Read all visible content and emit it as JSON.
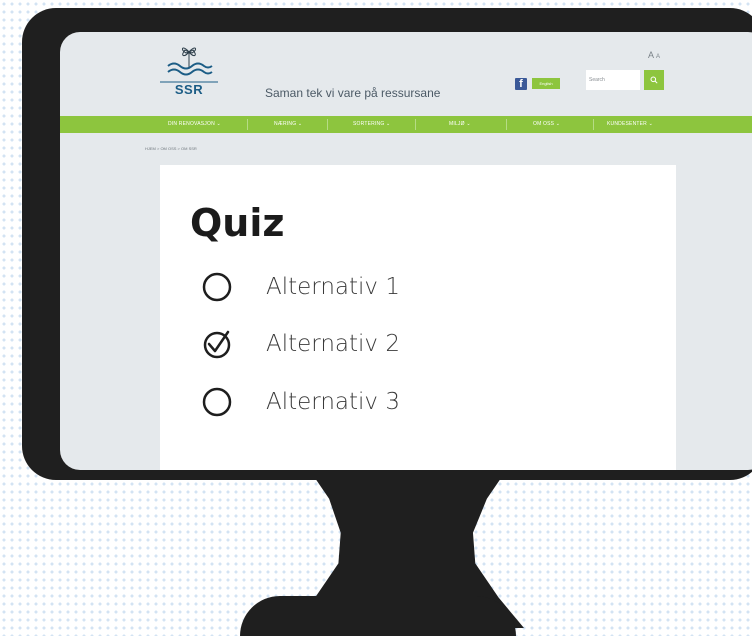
{
  "site": {
    "logo_text": "SSR",
    "tagline": "Saman tek vi vare på ressursane",
    "language_button": "English",
    "font_size_large": "A",
    "font_size_small": "A",
    "search_placeholder": "Search",
    "social_icon": "facebook-icon",
    "accent_color": "#8dc53e"
  },
  "nav": {
    "items": [
      {
        "label": "DIN RENOVASJON ⌄"
      },
      {
        "label": "NÆRING ⌄"
      },
      {
        "label": "SORTERING ⌄"
      },
      {
        "label": "MILJØ ⌄"
      },
      {
        "label": "OM OSS ⌄"
      },
      {
        "label": "KUNDESENTER ⌄"
      }
    ]
  },
  "breadcrumb": "HJEM > OM OSS > OM SSR",
  "quiz": {
    "title": "Quiz",
    "options": [
      {
        "label": "Alternativ 1",
        "checked": false
      },
      {
        "label": "Alternativ 2",
        "checked": true
      },
      {
        "label": "Alternativ 3",
        "checked": false
      }
    ]
  }
}
